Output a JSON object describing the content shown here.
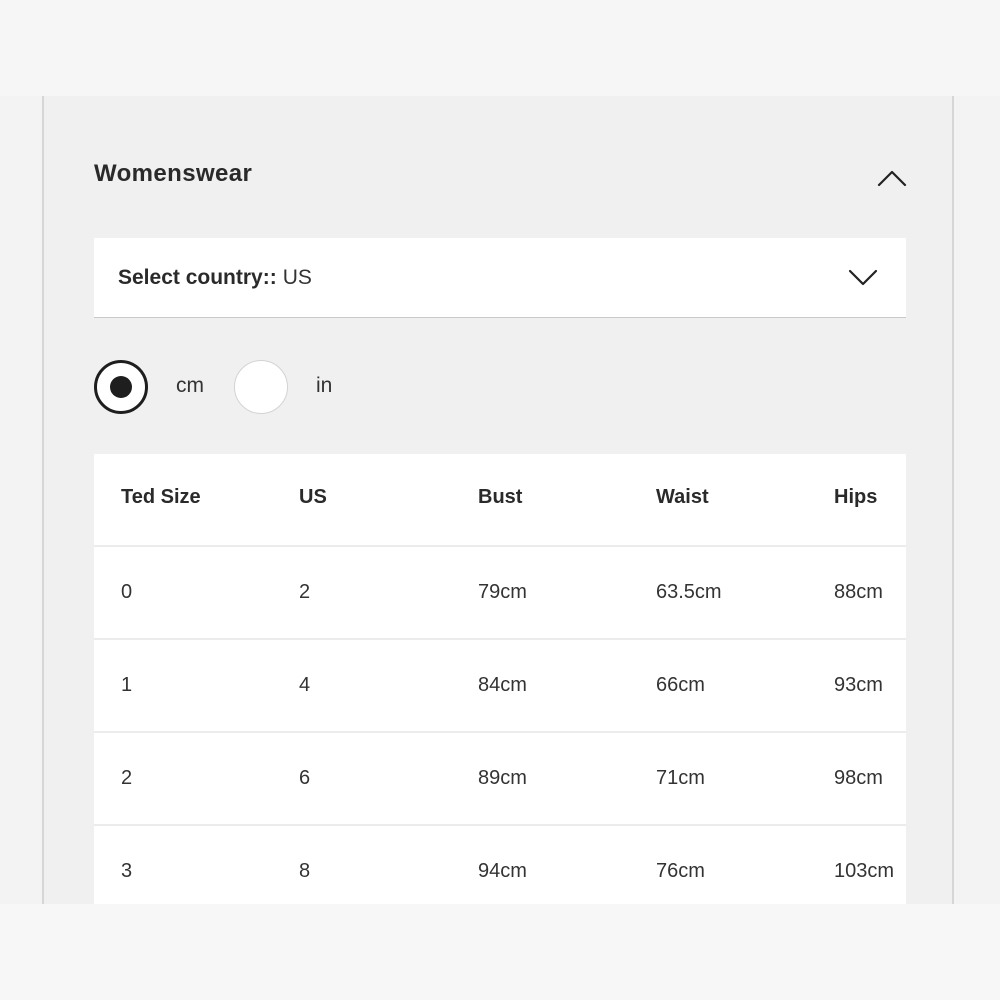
{
  "section": {
    "title": "Womenswear"
  },
  "country_select": {
    "label": "Select country::",
    "value": "US"
  },
  "units": [
    {
      "label": "cm",
      "selected": true
    },
    {
      "label": "in",
      "selected": false
    }
  ],
  "size_table": {
    "headers": [
      "Ted Size",
      "US",
      "Bust",
      "Waist",
      "Hips"
    ],
    "rows": [
      [
        "0",
        "2",
        "79cm",
        "63.5cm",
        "88cm"
      ],
      [
        "1",
        "4",
        "84cm",
        "66cm",
        "93cm"
      ],
      [
        "2",
        "6",
        "89cm",
        "71cm",
        "98cm"
      ],
      [
        "3",
        "8",
        "94cm",
        "76cm",
        "103cm"
      ]
    ]
  },
  "icons": {
    "collapse": "chevron-up-icon",
    "country_dropdown": "chevron-down-icon"
  }
}
